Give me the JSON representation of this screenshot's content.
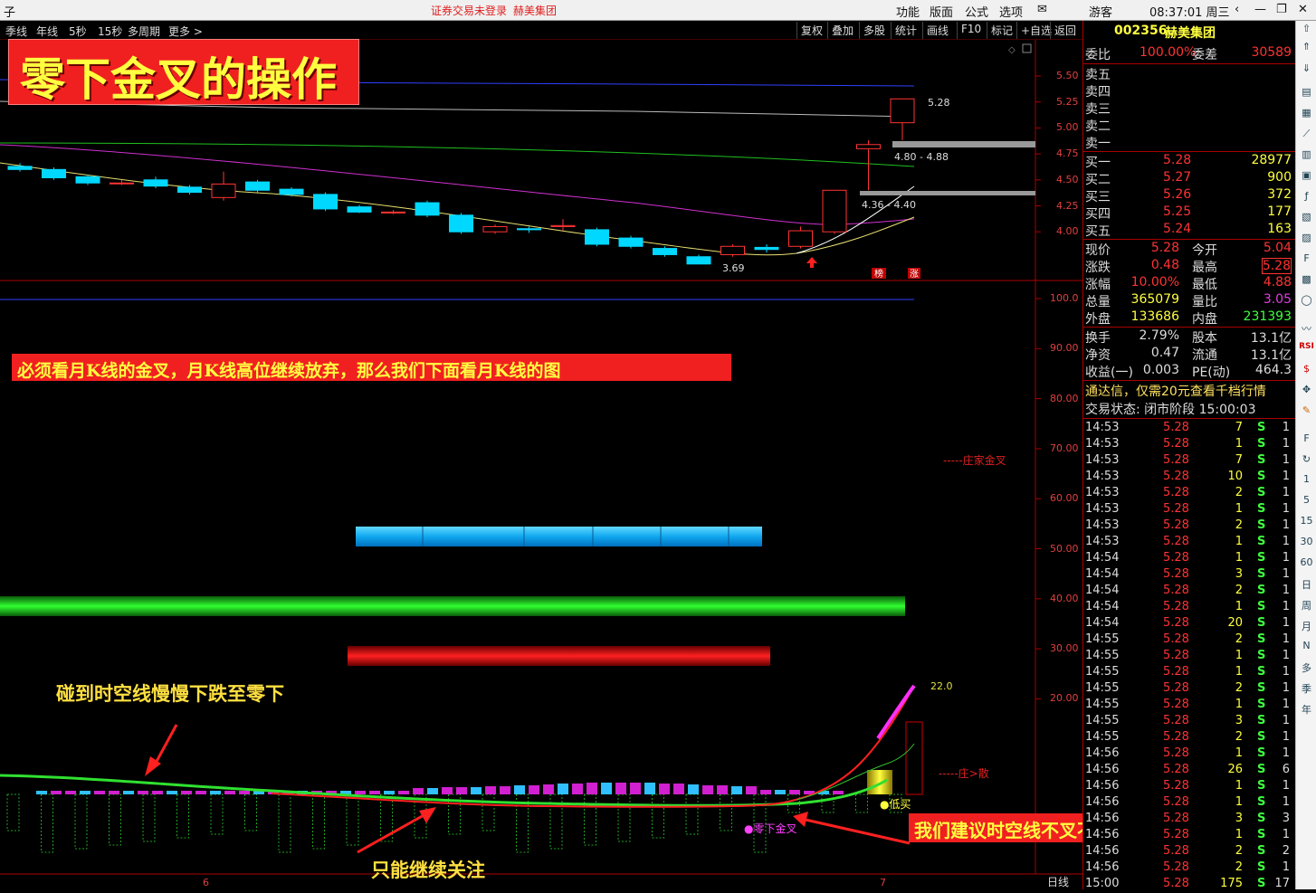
{
  "window": {
    "app_char": "子",
    "center_left": "证券交易未登录",
    "center_right": "赫美集团",
    "menu": [
      "功能",
      "版面",
      "公式",
      "选项"
    ],
    "user": "游客",
    "clock": "08:37:01 周三"
  },
  "toolbar": {
    "periods": [
      "季线",
      "年线",
      "5秒",
      "15秒",
      "多周期",
      "更多 >"
    ],
    "right_buttons": [
      "复权",
      "叠加",
      "多股",
      "统计",
      "画线",
      "F10",
      "标记",
      "+自选",
      "返回"
    ]
  },
  "price_axis": [
    "5.50",
    "5.25",
    "5.00",
    "4.75",
    "4.50",
    "4.25",
    "4.00"
  ],
  "indicator_axis": [
    "100.0",
    "90.00",
    "80.00",
    "70.00",
    "60.00",
    "50.00",
    "40.00",
    "30.00",
    "20.00"
  ],
  "annotations": {
    "title": "零下金叉的操作",
    "note_month": "必须看月K线的金叉，月K线高位继续放弃，那么我们下面看月K线的图",
    "note_fall": "碰到时空线慢慢下跌至零下",
    "note_watch": "只能继续关注",
    "note_rule": "我们建议时空线不叉不买的原则",
    "price_hi": "5.28",
    "price_lo": "3.69",
    "range1": "4.80 - 4.88",
    "range2": "4.36 - 4.40",
    "badge1": "榜",
    "badge2": "涨",
    "zj_cross": "-----庄家金叉",
    "zj_scatter": "-----庄>散",
    "val_22": "22.0",
    "low_buy": "●低买",
    "zero_cross": "●零下金叉",
    "date_6": "6",
    "date_7": "7",
    "period_label": "日线"
  },
  "colors": {
    "up": "#ff3333",
    "down": "#00d8ff",
    "ma_yellow": "#e8e070",
    "ma_purple": "#d030d0",
    "ma_green": "#20b020",
    "ma_blue": "#3040ff"
  },
  "candles": [
    {
      "o": 4.63,
      "c": 4.6,
      "h": 4.66,
      "l": 4.58
    },
    {
      "o": 4.6,
      "c": 4.52,
      "h": 4.62,
      "l": 4.5
    },
    {
      "o": 4.53,
      "c": 4.47,
      "h": 4.55,
      "l": 4.45
    },
    {
      "o": 4.47,
      "c": 4.47,
      "h": 4.5,
      "l": 4.45
    },
    {
      "o": 4.5,
      "c": 4.44,
      "h": 4.53,
      "l": 4.42
    },
    {
      "o": 4.43,
      "c": 4.38,
      "h": 4.45,
      "l": 4.36
    },
    {
      "o": 4.33,
      "c": 4.46,
      "h": 4.58,
      "l": 4.3
    },
    {
      "o": 4.48,
      "c": 4.4,
      "h": 4.5,
      "l": 4.38
    },
    {
      "o": 4.41,
      "c": 4.36,
      "h": 4.43,
      "l": 4.34
    },
    {
      "o": 4.36,
      "c": 4.22,
      "h": 4.38,
      "l": 4.2
    },
    {
      "o": 4.24,
      "c": 4.19,
      "h": 4.26,
      "l": 4.18
    },
    {
      "o": 4.19,
      "c": 4.19,
      "h": 4.21,
      "l": 4.17
    },
    {
      "o": 4.28,
      "c": 4.16,
      "h": 4.3,
      "l": 4.14
    },
    {
      "o": 4.16,
      "c": 4.0,
      "h": 4.18,
      "l": 3.98
    },
    {
      "o": 4.0,
      "c": 4.05,
      "h": 4.07,
      "l": 3.98
    },
    {
      "o": 4.03,
      "c": 4.02,
      "h": 4.05,
      "l": 3.99
    },
    {
      "o": 4.05,
      "c": 4.06,
      "h": 4.12,
      "l": 4.01
    },
    {
      "o": 4.02,
      "c": 3.88,
      "h": 4.04,
      "l": 3.86
    },
    {
      "o": 3.94,
      "c": 3.86,
      "h": 3.96,
      "l": 3.84
    },
    {
      "o": 3.84,
      "c": 3.78,
      "h": 3.86,
      "l": 3.76
    },
    {
      "o": 3.76,
      "c": 3.69,
      "h": 3.78,
      "l": 3.69
    },
    {
      "o": 3.78,
      "c": 3.86,
      "h": 3.88,
      "l": 3.76
    },
    {
      "o": 3.85,
      "c": 3.83,
      "h": 3.88,
      "l": 3.8
    },
    {
      "o": 3.86,
      "c": 4.01,
      "h": 4.05,
      "l": 3.84
    },
    {
      "o": 4.0,
      "c": 4.4,
      "h": 4.4,
      "l": 3.98
    },
    {
      "o": 4.8,
      "c": 4.84,
      "h": 4.88,
      "l": 4.4
    },
    {
      "o": 5.05,
      "c": 5.28,
      "h": 5.28,
      "l": 4.88
    }
  ],
  "quote": {
    "code": "002356",
    "name": "赫美集团",
    "weibi_label": "委比",
    "weibi": "100.00%",
    "weicha_label": "委差",
    "weicha": "30589",
    "sells": [
      "卖五",
      "卖四",
      "卖三",
      "卖二",
      "卖一"
    ],
    "buys": [
      {
        "label": "买一",
        "price": "5.28",
        "vol": "28977"
      },
      {
        "label": "买二",
        "price": "5.27",
        "vol": "900"
      },
      {
        "label": "买三",
        "price": "5.26",
        "vol": "372"
      },
      {
        "label": "买四",
        "price": "5.25",
        "vol": "177"
      },
      {
        "label": "买五",
        "price": "5.24",
        "vol": "163"
      }
    ],
    "stats": [
      {
        "k1": "现价",
        "v1": "5.28",
        "k2": "今开",
        "v2": "5.04"
      },
      {
        "k1": "涨跌",
        "v1": "0.48",
        "k2": "最高",
        "v2": "5.28"
      },
      {
        "k1": "涨幅",
        "v1": "10.00%",
        "k2": "最低",
        "v2": "4.88"
      },
      {
        "k1": "总量",
        "v1": "365079",
        "k2": "量比",
        "v2": "3.05"
      },
      {
        "k1": "外盘",
        "v1": "133686",
        "k2": "内盘",
        "v2": "231393"
      }
    ],
    "stats2": [
      {
        "k1": "换手",
        "v1": "2.79%",
        "k2": "股本",
        "v2": "13.1亿"
      },
      {
        "k1": "净资",
        "v1": "0.47",
        "k2": "流通",
        "v2": "13.1亿"
      },
      {
        "k1": "收益(一)",
        "v1": "0.003",
        "k2": "PE(动)",
        "v2": "464.3"
      }
    ],
    "promo": "通达信，仅需20元查看千档行情",
    "status": "交易状态: 闭市阶段 15:00:03"
  },
  "ticks": [
    [
      "14:53",
      "5.28",
      "7",
      "S",
      "1"
    ],
    [
      "14:53",
      "5.28",
      "1",
      "S",
      "1"
    ],
    [
      "14:53",
      "5.28",
      "7",
      "S",
      "1"
    ],
    [
      "14:53",
      "5.28",
      "10",
      "S",
      "1"
    ],
    [
      "14:53",
      "5.28",
      "2",
      "S",
      "1"
    ],
    [
      "14:53",
      "5.28",
      "1",
      "S",
      "1"
    ],
    [
      "14:53",
      "5.28",
      "2",
      "S",
      "1"
    ],
    [
      "14:53",
      "5.28",
      "1",
      "S",
      "1"
    ],
    [
      "14:54",
      "5.28",
      "1",
      "S",
      "1"
    ],
    [
      "14:54",
      "5.28",
      "3",
      "S",
      "1"
    ],
    [
      "14:54",
      "5.28",
      "2",
      "S",
      "1"
    ],
    [
      "14:54",
      "5.28",
      "1",
      "S",
      "1"
    ],
    [
      "14:54",
      "5.28",
      "20",
      "S",
      "1"
    ],
    [
      "14:55",
      "5.28",
      "2",
      "S",
      "1"
    ],
    [
      "14:55",
      "5.28",
      "1",
      "S",
      "1"
    ],
    [
      "14:55",
      "5.28",
      "1",
      "S",
      "1"
    ],
    [
      "14:55",
      "5.28",
      "2",
      "S",
      "1"
    ],
    [
      "14:55",
      "5.28",
      "1",
      "S",
      "1"
    ],
    [
      "14:55",
      "5.28",
      "3",
      "S",
      "1"
    ],
    [
      "14:55",
      "5.28",
      "2",
      "S",
      "1"
    ],
    [
      "14:56",
      "5.28",
      "1",
      "S",
      "1"
    ],
    [
      "14:56",
      "5.28",
      "26",
      "S",
      "6"
    ],
    [
      "14:56",
      "5.28",
      "1",
      "S",
      "1"
    ],
    [
      "14:56",
      "5.28",
      "1",
      "S",
      "1"
    ],
    [
      "14:56",
      "5.28",
      "3",
      "S",
      "3"
    ],
    [
      "14:56",
      "5.28",
      "1",
      "S",
      "1"
    ],
    [
      "14:56",
      "5.28",
      "2",
      "S",
      "2"
    ],
    [
      "14:56",
      "5.28",
      "2",
      "S",
      "1"
    ],
    [
      "15:00",
      "5.28",
      "175",
      "S",
      "17"
    ]
  ],
  "side_icons": [
    "1",
    "5",
    "15",
    "30",
    "60",
    "日",
    "周",
    "月",
    "N",
    "多",
    "季",
    "年"
  ]
}
